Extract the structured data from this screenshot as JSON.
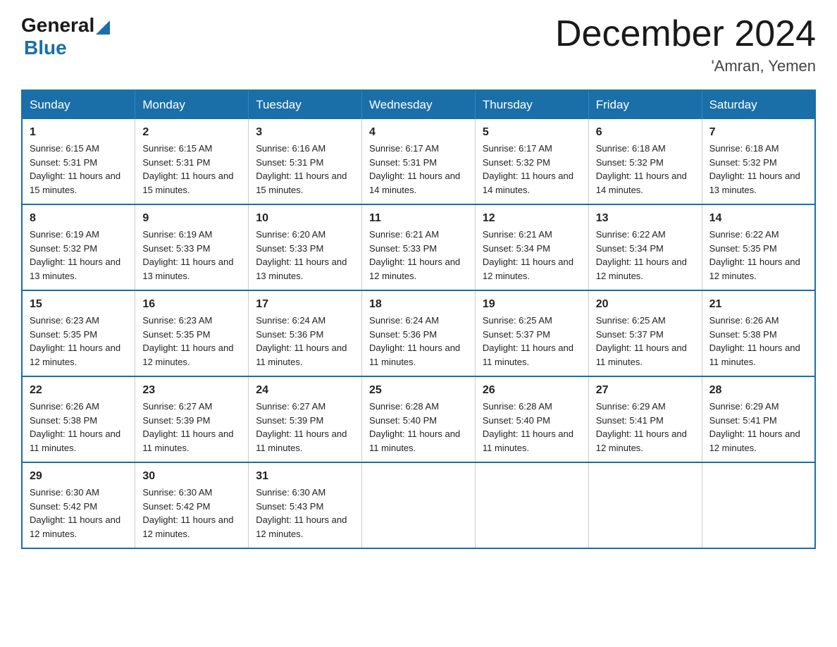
{
  "header": {
    "logo_general": "General",
    "logo_blue": "Blue",
    "title": "December 2024",
    "location": "'Amran, Yemen"
  },
  "columns": [
    "Sunday",
    "Monday",
    "Tuesday",
    "Wednesday",
    "Thursday",
    "Friday",
    "Saturday"
  ],
  "weeks": [
    [
      {
        "day": "1",
        "sunrise": "6:15 AM",
        "sunset": "5:31 PM",
        "daylight": "11 hours and 15 minutes."
      },
      {
        "day": "2",
        "sunrise": "6:15 AM",
        "sunset": "5:31 PM",
        "daylight": "11 hours and 15 minutes."
      },
      {
        "day": "3",
        "sunrise": "6:16 AM",
        "sunset": "5:31 PM",
        "daylight": "11 hours and 15 minutes."
      },
      {
        "day": "4",
        "sunrise": "6:17 AM",
        "sunset": "5:31 PM",
        "daylight": "11 hours and 14 minutes."
      },
      {
        "day": "5",
        "sunrise": "6:17 AM",
        "sunset": "5:32 PM",
        "daylight": "11 hours and 14 minutes."
      },
      {
        "day": "6",
        "sunrise": "6:18 AM",
        "sunset": "5:32 PM",
        "daylight": "11 hours and 14 minutes."
      },
      {
        "day": "7",
        "sunrise": "6:18 AM",
        "sunset": "5:32 PM",
        "daylight": "11 hours and 13 minutes."
      }
    ],
    [
      {
        "day": "8",
        "sunrise": "6:19 AM",
        "sunset": "5:32 PM",
        "daylight": "11 hours and 13 minutes."
      },
      {
        "day": "9",
        "sunrise": "6:19 AM",
        "sunset": "5:33 PM",
        "daylight": "11 hours and 13 minutes."
      },
      {
        "day": "10",
        "sunrise": "6:20 AM",
        "sunset": "5:33 PM",
        "daylight": "11 hours and 13 minutes."
      },
      {
        "day": "11",
        "sunrise": "6:21 AM",
        "sunset": "5:33 PM",
        "daylight": "11 hours and 12 minutes."
      },
      {
        "day": "12",
        "sunrise": "6:21 AM",
        "sunset": "5:34 PM",
        "daylight": "11 hours and 12 minutes."
      },
      {
        "day": "13",
        "sunrise": "6:22 AM",
        "sunset": "5:34 PM",
        "daylight": "11 hours and 12 minutes."
      },
      {
        "day": "14",
        "sunrise": "6:22 AM",
        "sunset": "5:35 PM",
        "daylight": "11 hours and 12 minutes."
      }
    ],
    [
      {
        "day": "15",
        "sunrise": "6:23 AM",
        "sunset": "5:35 PM",
        "daylight": "11 hours and 12 minutes."
      },
      {
        "day": "16",
        "sunrise": "6:23 AM",
        "sunset": "5:35 PM",
        "daylight": "11 hours and 12 minutes."
      },
      {
        "day": "17",
        "sunrise": "6:24 AM",
        "sunset": "5:36 PM",
        "daylight": "11 hours and 11 minutes."
      },
      {
        "day": "18",
        "sunrise": "6:24 AM",
        "sunset": "5:36 PM",
        "daylight": "11 hours and 11 minutes."
      },
      {
        "day": "19",
        "sunrise": "6:25 AM",
        "sunset": "5:37 PM",
        "daylight": "11 hours and 11 minutes."
      },
      {
        "day": "20",
        "sunrise": "6:25 AM",
        "sunset": "5:37 PM",
        "daylight": "11 hours and 11 minutes."
      },
      {
        "day": "21",
        "sunrise": "6:26 AM",
        "sunset": "5:38 PM",
        "daylight": "11 hours and 11 minutes."
      }
    ],
    [
      {
        "day": "22",
        "sunrise": "6:26 AM",
        "sunset": "5:38 PM",
        "daylight": "11 hours and 11 minutes."
      },
      {
        "day": "23",
        "sunrise": "6:27 AM",
        "sunset": "5:39 PM",
        "daylight": "11 hours and 11 minutes."
      },
      {
        "day": "24",
        "sunrise": "6:27 AM",
        "sunset": "5:39 PM",
        "daylight": "11 hours and 11 minutes."
      },
      {
        "day": "25",
        "sunrise": "6:28 AM",
        "sunset": "5:40 PM",
        "daylight": "11 hours and 11 minutes."
      },
      {
        "day": "26",
        "sunrise": "6:28 AM",
        "sunset": "5:40 PM",
        "daylight": "11 hours and 11 minutes."
      },
      {
        "day": "27",
        "sunrise": "6:29 AM",
        "sunset": "5:41 PM",
        "daylight": "11 hours and 12 minutes."
      },
      {
        "day": "28",
        "sunrise": "6:29 AM",
        "sunset": "5:41 PM",
        "daylight": "11 hours and 12 minutes."
      }
    ],
    [
      {
        "day": "29",
        "sunrise": "6:30 AM",
        "sunset": "5:42 PM",
        "daylight": "11 hours and 12 minutes."
      },
      {
        "day": "30",
        "sunrise": "6:30 AM",
        "sunset": "5:42 PM",
        "daylight": "11 hours and 12 minutes."
      },
      {
        "day": "31",
        "sunrise": "6:30 AM",
        "sunset": "5:43 PM",
        "daylight": "11 hours and 12 minutes."
      },
      null,
      null,
      null,
      null
    ]
  ]
}
